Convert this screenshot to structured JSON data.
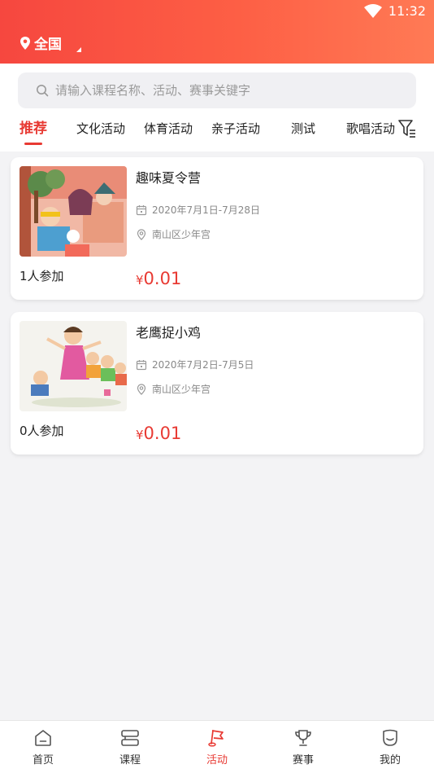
{
  "status_bar": {
    "time": "11:32"
  },
  "header": {
    "location": "全国"
  },
  "search": {
    "placeholder": "请输入课程名称、活动、赛事关键字"
  },
  "tabs": [
    {
      "label": "推荐",
      "active": true
    },
    {
      "label": "文化活动"
    },
    {
      "label": "体育活动"
    },
    {
      "label": "亲子活动"
    },
    {
      "label": "测试"
    },
    {
      "label": "歌唱活动"
    }
  ],
  "activities": [
    {
      "title": "趣味夏令营",
      "date": "2020年7月1日-7月28日",
      "location": "南山区少年宫",
      "joined": "1人参加",
      "currency": "¥",
      "price": "0.01"
    },
    {
      "title": "老鹰捉小鸡",
      "date": "2020年7月2日-7月5日",
      "location": "南山区少年宫",
      "joined": "0人参加",
      "currency": "¥",
      "price": "0.01"
    }
  ],
  "bottom_nav": [
    {
      "label": "首页",
      "icon": "home-icon"
    },
    {
      "label": "课程",
      "icon": "course-icon"
    },
    {
      "label": "活动",
      "icon": "activity-flag-icon",
      "active": true
    },
    {
      "label": "赛事",
      "icon": "trophy-icon"
    },
    {
      "label": "我的",
      "icon": "profile-icon"
    }
  ],
  "colors": {
    "accent": "#e83a33",
    "header_start": "#f6473f",
    "header_end": "#ff7a55"
  }
}
